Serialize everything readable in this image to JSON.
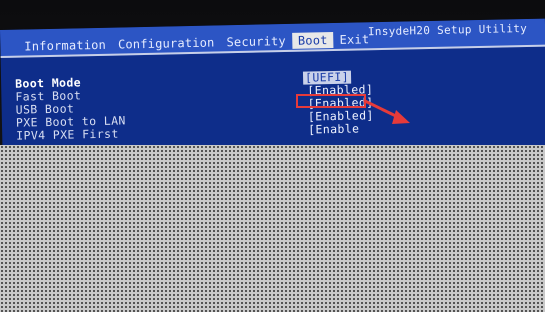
{
  "header": {
    "utility_title": "InsydeH20 Setup Utility",
    "tabs": [
      {
        "label": "Information",
        "active": false
      },
      {
        "label": "Configuration",
        "active": false
      },
      {
        "label": "Security",
        "active": false
      },
      {
        "label": "Boot",
        "active": true
      },
      {
        "label": "Exit",
        "active": false
      }
    ]
  },
  "settings": [
    {
      "label": "Boot Mode",
      "value": "[UEFI]"
    },
    {
      "label": "Fast Boot",
      "value": "[Enabled]"
    },
    {
      "label": "USB Boot",
      "value": "[Enabled]"
    },
    {
      "label": "PXE Boot to LAN",
      "value": "[Enabled]"
    },
    {
      "label": "IPV4 PXE First",
      "value": "[Enable"
    }
  ],
  "colors": {
    "screen_bg": "#0e2d8a",
    "titlebar_bg": "#2c55c4",
    "annotation_red": "#e53a3a"
  }
}
